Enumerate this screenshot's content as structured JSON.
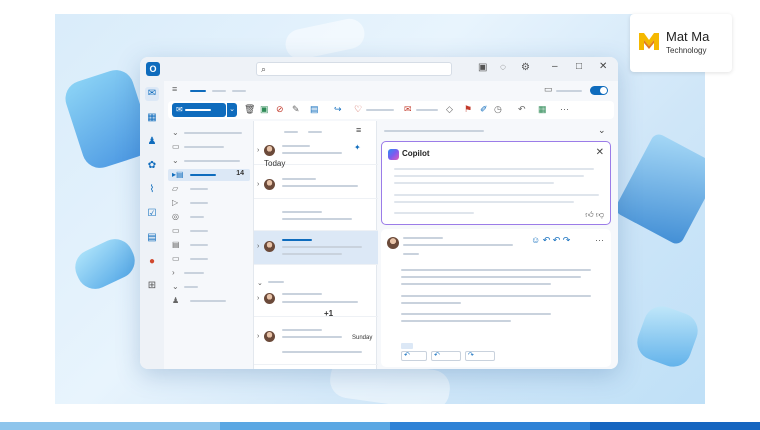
{
  "brand": {
    "name": "Mat Ma",
    "subtitle": "Technology",
    "colors": [
      "#f5b800",
      "#e07a1f",
      "#f7d46a"
    ]
  },
  "app": {
    "logo_icon": "outlook-logo",
    "search_placeholder": "",
    "toolbar_labels": {
      "today": "Today",
      "count": "14",
      "extra_recipients": "+1",
      "weekday": "Sunday"
    },
    "copilot": {
      "title": "Copilot"
    },
    "accent": "#0f6cbd",
    "copilot_border": "#9b7ce8"
  },
  "bottom_bar_colors": [
    "#8ec5ec",
    "#5aa7e3",
    "#2e82d6",
    "#1565c0"
  ]
}
